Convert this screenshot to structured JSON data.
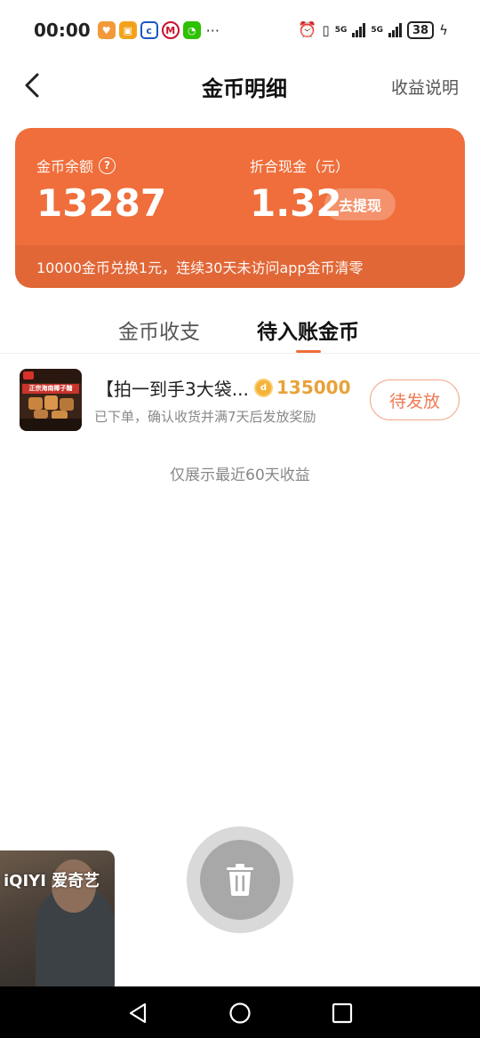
{
  "status_bar": {
    "time": "00:00",
    "more": "···",
    "network_label": "5G",
    "battery_level": "38"
  },
  "header": {
    "title": "金币明细",
    "right_link": "收益说明"
  },
  "balance_card": {
    "coin_label": "金币余额",
    "coin_value": "13287",
    "cash_label": "折合现金（元）",
    "cash_value": "1.32",
    "withdraw_label": "去提现",
    "footer_note": "10000金币兑换1元，连续30天未访问app金币清零",
    "color": "#ef6e3b"
  },
  "tabs": [
    {
      "label": "金币收支",
      "active": false
    },
    {
      "label": "待入账金币",
      "active": true
    }
  ],
  "pending_items": [
    {
      "title": "【拍一到手3大袋...",
      "coins": "135000",
      "subtitle": "已下单，确认收货并满7天后发放奖励",
      "status_button": "待发放",
      "thumb_text": "正宗海南椰子糖"
    }
  ],
  "footnote": "仅展示最近60天收益",
  "pip": {
    "brand": "iQIYI 爱奇艺"
  },
  "icons": {
    "back": "chevron-left-icon",
    "help": "question-circle-icon",
    "coin": "coin-icon",
    "delete": "trash-icon"
  }
}
